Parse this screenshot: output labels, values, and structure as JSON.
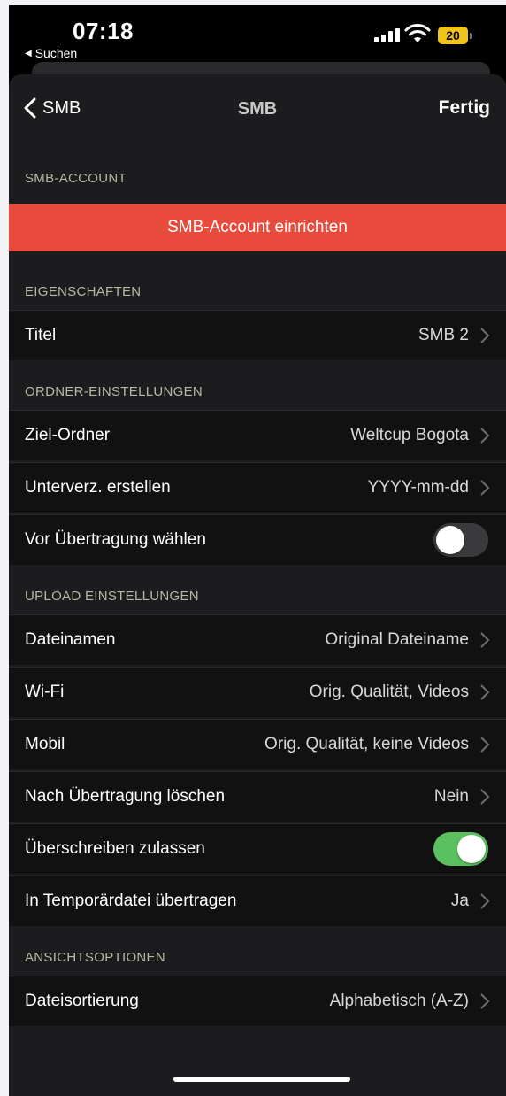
{
  "status_bar": {
    "time": "07:18",
    "back_app": "Suchen",
    "battery": "20"
  },
  "nav": {
    "back_label": "SMB",
    "title": "SMB",
    "done_label": "Fertig"
  },
  "sections": {
    "account": {
      "header": "SMB-ACCOUNT",
      "setup_button": "SMB-Account einrichten"
    },
    "properties": {
      "header": "EIGENSCHAFTEN",
      "rows": [
        {
          "label": "Titel",
          "value": "SMB 2"
        }
      ]
    },
    "folder": {
      "header": "ORDNER-EINSTELLUNGEN",
      "rows": [
        {
          "label": "Ziel-Ordner",
          "value": "Weltcup Bogota"
        },
        {
          "label": "Unterverz. erstellen",
          "value": "YYYY-mm-dd"
        },
        {
          "label": "Vor Übertragung wählen",
          "toggle": false
        }
      ]
    },
    "upload": {
      "header": "UPLOAD EINSTELLUNGEN",
      "rows": [
        {
          "label": "Dateinamen",
          "value": "Original Dateiname"
        },
        {
          "label": "Wi-Fi",
          "value": "Orig. Qualität, Videos"
        },
        {
          "label": "Mobil",
          "value": "Orig. Qualität, keine Videos"
        },
        {
          "label": "Nach Übertragung löschen",
          "value": "Nein"
        },
        {
          "label": "Überschreiben zulassen",
          "toggle": true
        },
        {
          "label": "In Temporärdatei übertragen",
          "value": "Ja"
        }
      ]
    },
    "view": {
      "header": "ANSICHTSOPTIONEN",
      "rows": [
        {
          "label": "Dateisortierung",
          "value": "Alphabetisch (A-Z)"
        }
      ]
    }
  },
  "colors": {
    "accent_red": "#e84a3c",
    "toggle_on": "#5ac15e",
    "toggle_off": "#3a3a3c"
  }
}
